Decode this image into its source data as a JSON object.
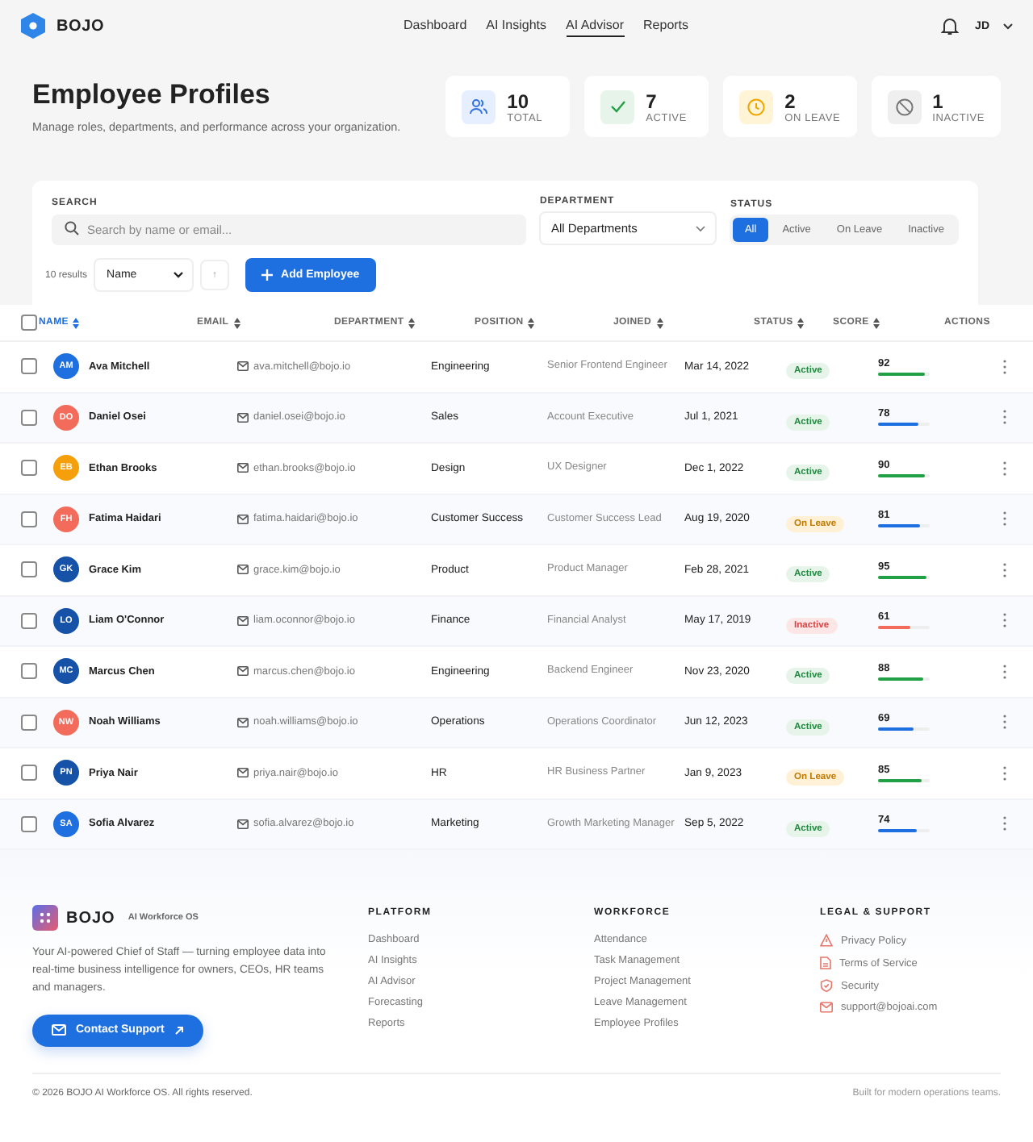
{
  "header": {
    "brand": "BOJO",
    "nav": [
      {
        "label": "Dashboard",
        "selected": false
      },
      {
        "label": "AI Insights",
        "selected": false
      },
      {
        "label": "AI Advisor",
        "selected": true
      },
      {
        "label": "Reports",
        "selected": false
      }
    ],
    "user": "JD"
  },
  "page": {
    "title": "Employee Profiles",
    "subtitle": "Manage roles, departments, and performance across your organization."
  },
  "stats": [
    {
      "kind": "total",
      "value": "10",
      "label": "TOTAL"
    },
    {
      "kind": "active",
      "value": "7",
      "label": "ACTIVE"
    },
    {
      "kind": "leave",
      "value": "2",
      "label": "ON LEAVE"
    },
    {
      "kind": "inactive",
      "value": "1",
      "label": "INACTIVE"
    }
  ],
  "filters": {
    "search_label": "SEARCH",
    "search_placeholder": "Search by name or email...",
    "department_label": "DEPARTMENT",
    "department_value": "All Departments",
    "status_label": "STATUS",
    "status_options": [
      {
        "label": "All",
        "selected": true
      },
      {
        "label": "Active",
        "selected": false
      },
      {
        "label": "On Leave",
        "selected": false
      },
      {
        "label": "Inactive",
        "selected": false
      }
    ],
    "results": "10 results",
    "sort_value": "Name",
    "sort_direction": "↑",
    "add_button": "Add Employee"
  },
  "table": {
    "select_all_checked": false,
    "columns": [
      {
        "label": "NAME",
        "selected": true
      },
      {
        "label": "EMAIL",
        "selected": false
      },
      {
        "label": "DEPARTMENT",
        "selected": false
      },
      {
        "label": "POSITION",
        "selected": false
      },
      {
        "label": "JOINED",
        "selected": false
      },
      {
        "label": "STATUS",
        "selected": false
      },
      {
        "label": "SCORE",
        "selected": false
      },
      {
        "label": "ACTIONS",
        "selected": false
      }
    ],
    "rows": [
      {
        "checked": false,
        "initials": "AM",
        "color": "#1e6fe0",
        "name": "Ava Mitchell",
        "email": "ava.mitchell@bojo.io",
        "department": "Engineering",
        "position": "Senior Frontend Engineer",
        "joined": "Mar 14, 2022",
        "status": {
          "kind": "active",
          "label": "Active"
        },
        "score": {
          "value": "92",
          "level": 0.92,
          "color": "#22a045"
        }
      },
      {
        "checked": false,
        "initials": "DO",
        "color": "#f26b5b",
        "name": "Daniel Osei",
        "email": "daniel.osei@bojo.io",
        "department": "Sales",
        "position": "Account Executive",
        "joined": "Jul 1, 2021",
        "status": {
          "kind": "active",
          "label": "Active"
        },
        "score": {
          "value": "78",
          "level": 0.78,
          "color": "#1e6fe0"
        }
      },
      {
        "checked": false,
        "initials": "EB",
        "color": "#f5a00a",
        "name": "Ethan Brooks",
        "email": "ethan.brooks@bojo.io",
        "department": "Design",
        "position": "UX Designer",
        "joined": "Dec 1, 2022",
        "status": {
          "kind": "active",
          "label": "Active"
        },
        "score": {
          "value": "90",
          "level": 0.9,
          "color": "#22a045"
        }
      },
      {
        "checked": false,
        "initials": "FH",
        "color": "#f26b5b",
        "name": "Fatima Haidari",
        "email": "fatima.haidari@bojo.io",
        "department": "Customer Success",
        "position": "Customer Success Lead",
        "joined": "Aug 19, 2020",
        "status": {
          "kind": "leave",
          "label": "On Leave"
        },
        "score": {
          "value": "81",
          "level": 0.81,
          "color": "#1e6fe0"
        }
      },
      {
        "checked": false,
        "initials": "GK",
        "color": "#1552a8",
        "name": "Grace Kim",
        "email": "grace.kim@bojo.io",
        "department": "Product",
        "position": "Product Manager",
        "joined": "Feb 28, 2021",
        "status": {
          "kind": "active",
          "label": "Active"
        },
        "score": {
          "value": "95",
          "level": 0.95,
          "color": "#22a045"
        }
      },
      {
        "checked": false,
        "initials": "LO",
        "color": "#1552a8",
        "name": "Liam O'Connor",
        "email": "liam.oconnor@bojo.io",
        "department": "Finance",
        "position": "Financial Analyst",
        "joined": "May 17, 2019",
        "status": {
          "kind": "inactive",
          "label": "Inactive"
        },
        "score": {
          "value": "61",
          "level": 0.61,
          "color": "#f26b5b"
        }
      },
      {
        "checked": false,
        "initials": "MC",
        "color": "#1552a8",
        "name": "Marcus Chen",
        "email": "marcus.chen@bojo.io",
        "department": "Engineering",
        "position": "Backend Engineer",
        "joined": "Nov 23, 2020",
        "status": {
          "kind": "active",
          "label": "Active"
        },
        "score": {
          "value": "88",
          "level": 0.88,
          "color": "#22a045"
        }
      },
      {
        "checked": false,
        "initials": "NW",
        "color": "#f26b5b",
        "name": "Noah Williams",
        "email": "noah.williams@bojo.io",
        "department": "Operations",
        "position": "Operations Coordinator",
        "joined": "Jun 12, 2023",
        "status": {
          "kind": "active",
          "label": "Active"
        },
        "score": {
          "value": "69",
          "level": 0.69,
          "color": "#1e6fe0"
        }
      },
      {
        "checked": false,
        "initials": "PN",
        "color": "#1552a8",
        "name": "Priya Nair",
        "email": "priya.nair@bojo.io",
        "department": "HR",
        "position": "HR Business Partner",
        "joined": "Jan 9, 2023",
        "status": {
          "kind": "leave",
          "label": "On Leave"
        },
        "score": {
          "value": "85",
          "level": 0.85,
          "color": "#22a045"
        }
      },
      {
        "checked": false,
        "initials": "SA",
        "color": "#1e6fe0",
        "name": "Sofia Alvarez",
        "email": "sofia.alvarez@bojo.io",
        "department": "Marketing",
        "position": "Growth Marketing Manager",
        "joined": "Sep 5, 2022",
        "status": {
          "kind": "active",
          "label": "Active"
        },
        "score": {
          "value": "74",
          "level": 0.74,
          "color": "#1e6fe0"
        }
      }
    ]
  },
  "footer": {
    "brand": "BOJO",
    "tagline": "AI Workforce OS",
    "description": "Your AI-powered Chief of Staff — turning employee data into real-time business intelligence for owners, CEOs, HR teams and managers.",
    "contact_button": "Contact Support",
    "columns": [
      {
        "heading": "PLATFORM",
        "links": [
          {
            "label": "Dashboard"
          },
          {
            "label": "AI Insights"
          },
          {
            "label": "AI Advisor"
          },
          {
            "label": "Forecasting"
          },
          {
            "label": "Reports"
          }
        ]
      },
      {
        "heading": "WORKFORCE",
        "links": [
          {
            "label": "Attendance"
          },
          {
            "label": "Task Management"
          },
          {
            "label": "Project Management"
          },
          {
            "label": "Leave Management"
          },
          {
            "label": "Employee Profiles"
          }
        ]
      },
      {
        "heading": "LEGAL & SUPPORT",
        "links": [
          {
            "label": "Privacy Policy",
            "kind": "privacy"
          },
          {
            "label": "Terms of Service",
            "kind": "terms"
          },
          {
            "label": "Security",
            "kind": "security"
          },
          {
            "label": "support@bojoai.com",
            "kind": "mail"
          }
        ]
      }
    ],
    "copyright": "© 2026 BOJO AI Workforce OS. All rights reserved.",
    "note": "Built for modern operations teams."
  }
}
